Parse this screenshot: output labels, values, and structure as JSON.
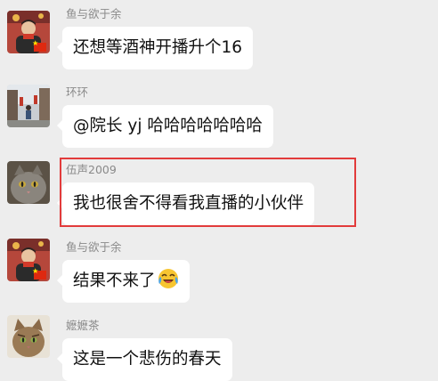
{
  "messages": [
    {
      "sender": "鱼与欲于余",
      "text": "还想等酒神开播升个16",
      "avatar": "avatar-man-red-scarf"
    },
    {
      "sender": "环环",
      "text": "@院长 yj  哈哈哈哈哈哈哈",
      "avatar": "avatar-street-photo"
    },
    {
      "sender": "伍声2009",
      "text": "我也很舍不得看我直播的小伙伴",
      "avatar": "avatar-gray-cat"
    },
    {
      "sender": "鱼与欲于余",
      "text": "结果不来了",
      "emoji": "crying-laughing-emoji",
      "avatar": "avatar-man-red-scarf"
    },
    {
      "sender": "嬷嬷茶",
      "text": "这是一个悲伤的春天",
      "avatar": "avatar-tabby-cat"
    }
  ],
  "highlight_color": "#e23b3b",
  "bubble_color": "#ffffff",
  "background_color": "#ededed"
}
